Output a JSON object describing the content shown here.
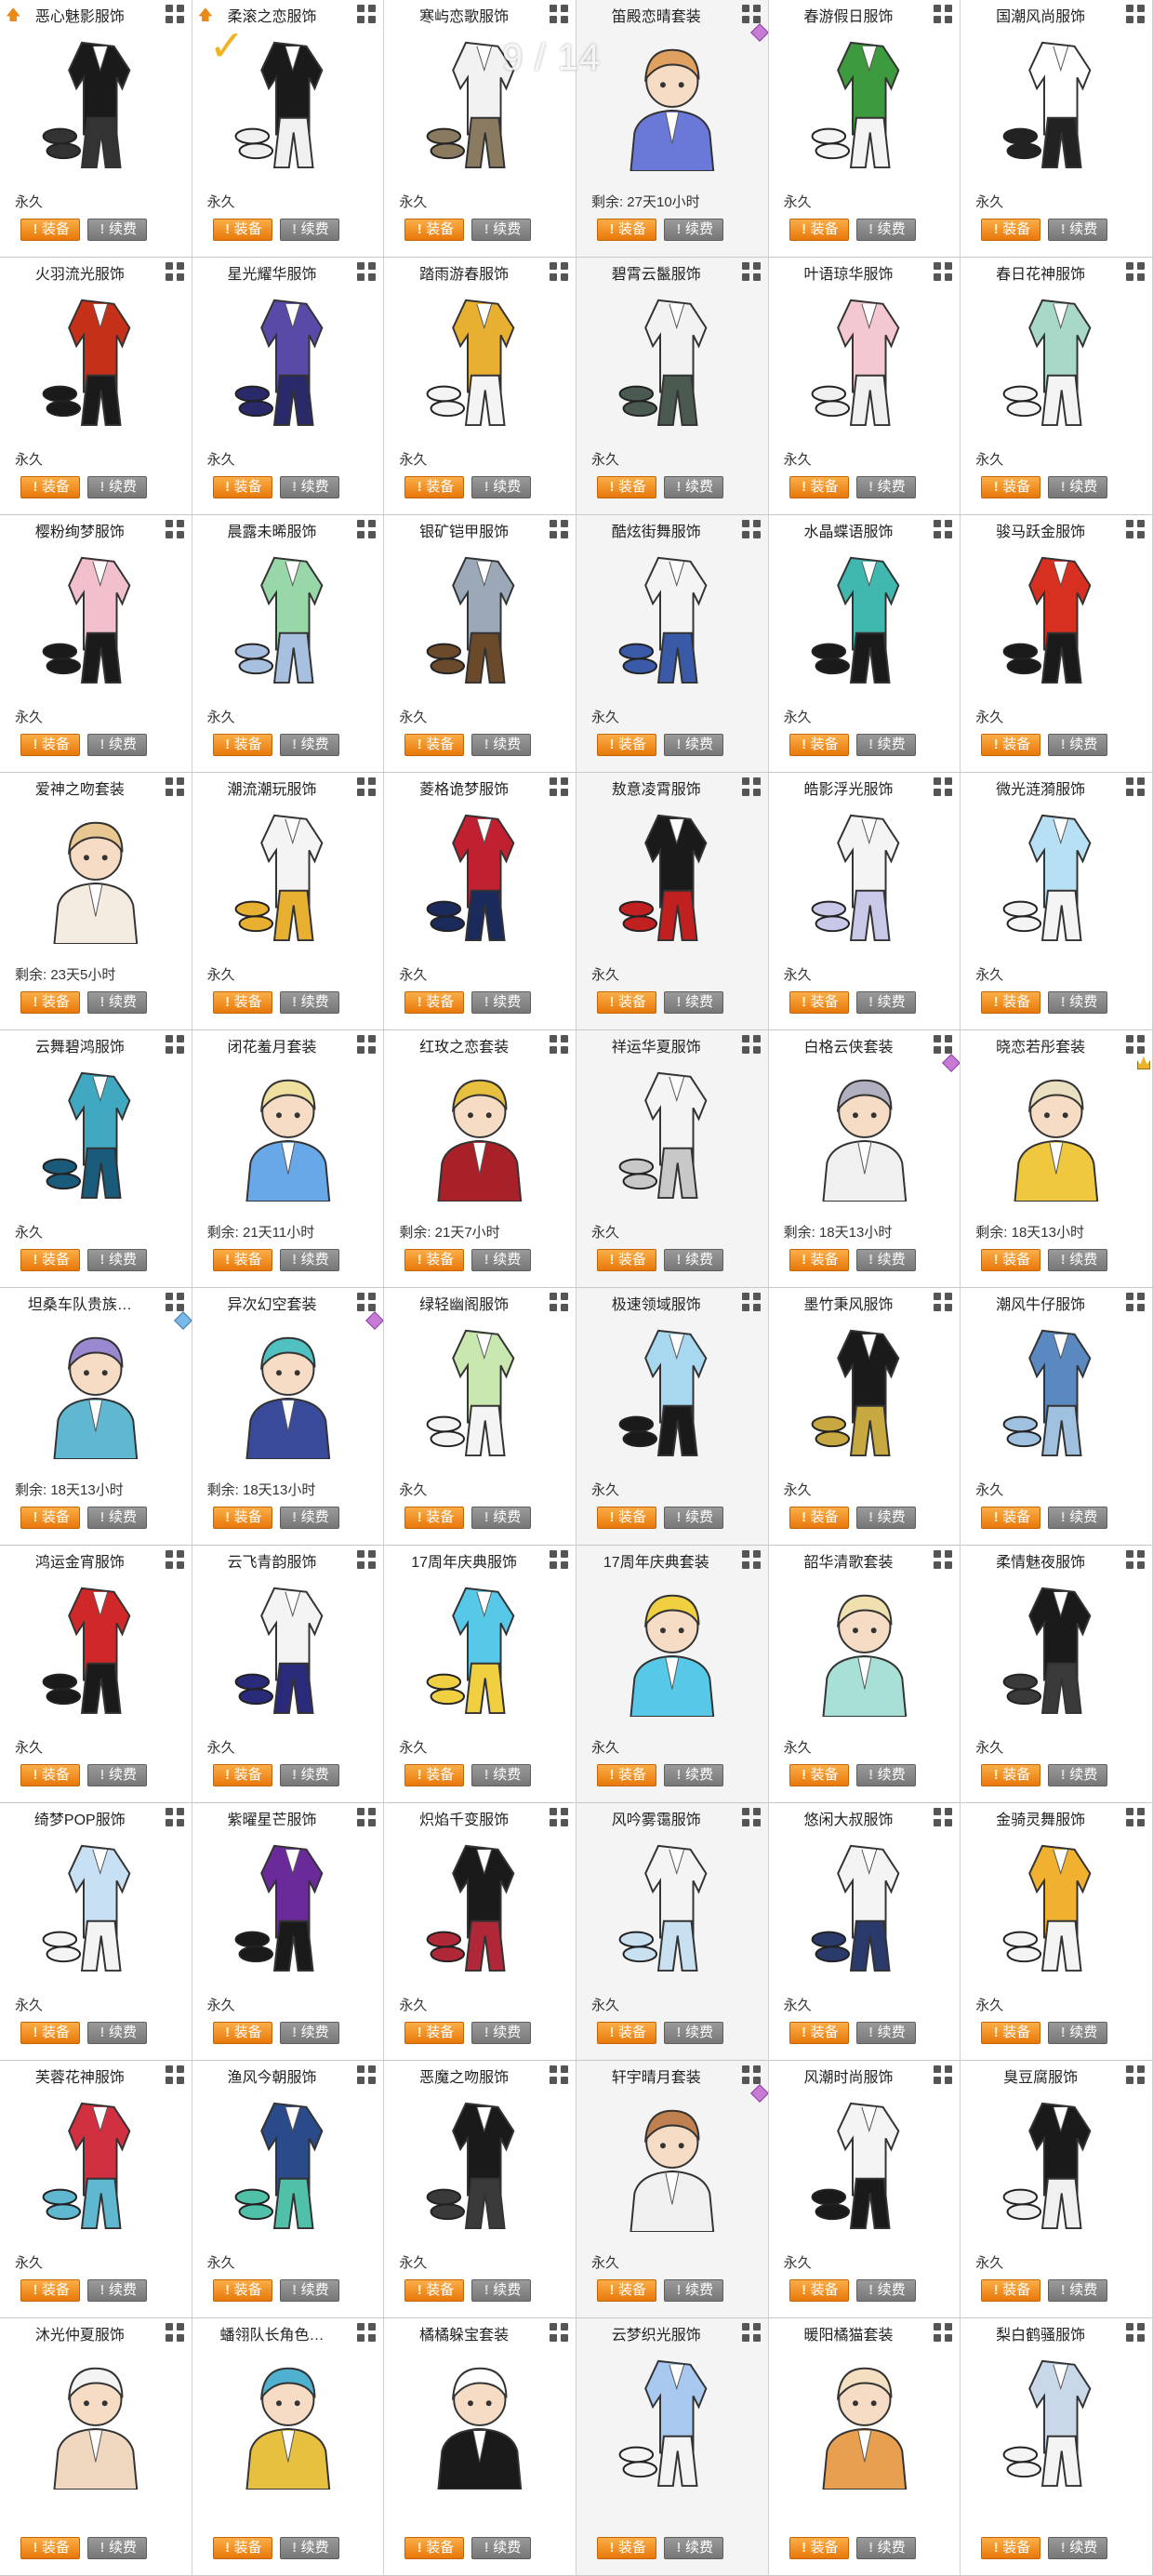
{
  "page_indicator": "9 / 14",
  "labels": {
    "equip": "装备",
    "renew": "续费"
  },
  "items": [
    {
      "name": "恶心魅影服饰",
      "status": "永久",
      "kind": "suit",
      "colors": [
        "#1a1a1a",
        "#333333"
      ],
      "badge": "up"
    },
    {
      "name": "柔滚之恋服饰",
      "status": "永久",
      "kind": "suit",
      "colors": [
        "#1a1a1a",
        "#f0f0f0"
      ],
      "badge": "up",
      "checked": true
    },
    {
      "name": "寒屿恋歌服饰",
      "status": "永久",
      "kind": "suit",
      "colors": [
        "#f2f2f2",
        "#8a7a60"
      ]
    },
    {
      "name": "笛殿恋晴套装",
      "status": "剩余: 27天10小时",
      "kind": "char",
      "colors": [
        "#6a78d8",
        "#e0a060"
      ],
      "gem": "pink"
    },
    {
      "name": "春游假日服饰",
      "status": "永久",
      "kind": "suit",
      "colors": [
        "#3e9a3e",
        "#f4f4f4"
      ]
    },
    {
      "name": "国潮风尚服饰",
      "status": "永久",
      "kind": "suit",
      "colors": [
        "#ffffff",
        "#222222"
      ]
    },
    {
      "name": "火羽流光服饰",
      "status": "永久",
      "kind": "suit",
      "colors": [
        "#c43018",
        "#1a1a1a"
      ]
    },
    {
      "name": "星光耀华服饰",
      "status": "永久",
      "kind": "suit",
      "colors": [
        "#5a4aa8",
        "#2a2a6a"
      ]
    },
    {
      "name": "踏雨游春服饰",
      "status": "永久",
      "kind": "suit",
      "colors": [
        "#e8b030",
        "#f4f4f4"
      ]
    },
    {
      "name": "碧霄云鬣服饰",
      "status": "永久",
      "kind": "suit",
      "colors": [
        "#f2f2f2",
        "#4a5a50"
      ]
    },
    {
      "name": "叶语琼华服饰",
      "status": "永久",
      "kind": "suit",
      "colors": [
        "#f4c8d0",
        "#f0f0f0"
      ]
    },
    {
      "name": "春日花神服饰",
      "status": "永久",
      "kind": "suit",
      "colors": [
        "#a8d8c8",
        "#f4f4f4"
      ]
    },
    {
      "name": "樱粉绚梦服饰",
      "status": "永久",
      "kind": "suit",
      "colors": [
        "#f2c0cc",
        "#1a1a1a"
      ]
    },
    {
      "name": "晨露未晞服饰",
      "status": "永久",
      "kind": "suit",
      "colors": [
        "#98d8a8",
        "#a8c0e0"
      ]
    },
    {
      "name": "银矿铠甲服饰",
      "status": "永久",
      "kind": "suit",
      "colors": [
        "#9aa8b8",
        "#6a4a2a"
      ]
    },
    {
      "name": "酷炫街舞服饰",
      "status": "永久",
      "kind": "suit",
      "colors": [
        "#f4f4f4",
        "#3a5aa8"
      ]
    },
    {
      "name": "水晶蝶语服饰",
      "status": "永久",
      "kind": "suit",
      "colors": [
        "#40b8b0",
        "#1a1a1a"
      ]
    },
    {
      "name": "骏马跃金服饰",
      "status": "永久",
      "kind": "suit",
      "colors": [
        "#d83020",
        "#1a1a1a"
      ]
    },
    {
      "name": "爱神之吻套装",
      "status": "剩余: 23天5小时",
      "kind": "char",
      "colors": [
        "#f4ece0",
        "#e8c890"
      ]
    },
    {
      "name": "潮流潮玩服饰",
      "status": "永久",
      "kind": "suit",
      "colors": [
        "#f4f4f4",
        "#e8b030"
      ]
    },
    {
      "name": "菱格诡梦服饰",
      "status": "永久",
      "kind": "suit",
      "colors": [
        "#c02030",
        "#1a2a5a"
      ]
    },
    {
      "name": "敖意凌霄服饰",
      "status": "永久",
      "kind": "suit",
      "colors": [
        "#1a1a1a",
        "#c02020"
      ]
    },
    {
      "name": "皓影浮光服饰",
      "status": "永久",
      "kind": "suit",
      "colors": [
        "#f4f4f4",
        "#c8c8e8"
      ]
    },
    {
      "name": "微光涟漪服饰",
      "status": "永久",
      "kind": "suit",
      "colors": [
        "#b8e0f4",
        "#f4f4f4"
      ]
    },
    {
      "name": "云舞碧鸿服饰",
      "status": "永久",
      "kind": "suit",
      "colors": [
        "#40a8c0",
        "#1a5a7a"
      ]
    },
    {
      "name": "闭花羞月套装",
      "status": "剩余: 21天11小时",
      "kind": "char",
      "colors": [
        "#68a8e8",
        "#f0e0a0"
      ]
    },
    {
      "name": "红玫之恋套装",
      "status": "剩余: 21天7小时",
      "kind": "char",
      "colors": [
        "#a82028",
        "#e8c040"
      ]
    },
    {
      "name": "祥运华夏服饰",
      "status": "永久",
      "kind": "suit",
      "colors": [
        "#f4f4f4",
        "#c8c8c8"
      ]
    },
    {
      "name": "白格云侠套装",
      "status": "剩余: 18天13小时",
      "kind": "char",
      "colors": [
        "#f0f0f0",
        "#b0b0c0"
      ],
      "gem": "pink"
    },
    {
      "name": "晓恋若彤套装",
      "status": "剩余: 18天13小时",
      "kind": "char",
      "colors": [
        "#f0c840",
        "#e8e0c0"
      ],
      "gem": "crown"
    },
    {
      "name": "坦桑车队贵族…",
      "status": "剩余: 18天13小时",
      "kind": "char",
      "colors": [
        "#60b8d0",
        "#9a88d0"
      ],
      "gem": "blue"
    },
    {
      "name": "异次幻空套装",
      "status": "剩余: 18天13小时",
      "kind": "char",
      "colors": [
        "#3a4a9a",
        "#50c0c0"
      ],
      "gem": "pink"
    },
    {
      "name": "绿轻幽阁服饰",
      "status": "永久",
      "kind": "suit",
      "colors": [
        "#c8e8b0",
        "#f4f4f4"
      ]
    },
    {
      "name": "极速领域服饰",
      "status": "永久",
      "kind": "suit",
      "colors": [
        "#a8d8f0",
        "#1a1a1a"
      ]
    },
    {
      "name": "墨竹秉风服饰",
      "status": "永久",
      "kind": "suit",
      "colors": [
        "#1a1a1a",
        "#c8a840"
      ]
    },
    {
      "name": "潮风牛仔服饰",
      "status": "永久",
      "kind": "suit",
      "colors": [
        "#5a88c0",
        "#a0c0e0"
      ]
    },
    {
      "name": "鸿运金宵服饰",
      "status": "永久",
      "kind": "suit",
      "colors": [
        "#d02828",
        "#1a1a1a"
      ]
    },
    {
      "name": "云飞青韵服饰",
      "status": "永久",
      "kind": "suit",
      "colors": [
        "#f4f4f4",
        "#2a2a7a"
      ]
    },
    {
      "name": "17周年庆典服饰",
      "status": "永久",
      "kind": "suit",
      "colors": [
        "#58c8e8",
        "#f0d040"
      ]
    },
    {
      "name": "17周年庆典套装",
      "status": "永久",
      "kind": "char",
      "colors": [
        "#58c8e8",
        "#f0d040"
      ]
    },
    {
      "name": "韶华清歌套装",
      "status": "永久",
      "kind": "char",
      "colors": [
        "#a8e0d8",
        "#f0e0b0"
      ]
    },
    {
      "name": "柔情魅夜服饰",
      "status": "永久",
      "kind": "suit",
      "colors": [
        "#1a1a1a",
        "#3a3a3a"
      ]
    },
    {
      "name": "绮梦POP服饰",
      "status": "永久",
      "kind": "suit",
      "colors": [
        "#c8e0f4",
        "#f4f4f4"
      ]
    },
    {
      "name": "紫曜星芒服饰",
      "status": "永久",
      "kind": "suit",
      "colors": [
        "#6a2a9a",
        "#1a1a1a"
      ]
    },
    {
      "name": "炽焰千变服饰",
      "status": "永久",
      "kind": "suit",
      "colors": [
        "#1a1a1a",
        "#b02838"
      ]
    },
    {
      "name": "风吟雾霭服饰",
      "status": "永久",
      "kind": "suit",
      "colors": [
        "#f4f4f4",
        "#c8e0f0"
      ]
    },
    {
      "name": "悠闲大叔服饰",
      "status": "永久",
      "kind": "suit",
      "colors": [
        "#f4f4f4",
        "#2a3a6a"
      ]
    },
    {
      "name": "金骑灵舞服饰",
      "status": "永久",
      "kind": "suit",
      "colors": [
        "#f0b030",
        "#f4f4f4"
      ]
    },
    {
      "name": "芙蓉花神服饰",
      "status": "永久",
      "kind": "suit",
      "colors": [
        "#d03040",
        "#60b8d0"
      ]
    },
    {
      "name": "渔风今朝服饰",
      "status": "永久",
      "kind": "suit",
      "colors": [
        "#2a4a8a",
        "#50c0a8"
      ]
    },
    {
      "name": "恶魔之吻服饰",
      "status": "永久",
      "kind": "suit",
      "colors": [
        "#1a1a1a",
        "#3a3a3a"
      ]
    },
    {
      "name": "轩宇晴月套装",
      "status": "永久",
      "kind": "char",
      "colors": [
        "#f0f0f0",
        "#c08050"
      ],
      "gem": "pink"
    },
    {
      "name": "风潮时尚服饰",
      "status": "永久",
      "kind": "suit",
      "colors": [
        "#f4f4f4",
        "#1a1a1a"
      ]
    },
    {
      "name": "臭豆腐服饰",
      "status": "永久",
      "kind": "suit",
      "colors": [
        "#1a1a1a",
        "#f0f0f0"
      ]
    },
    {
      "name": "沐光仲夏服饰",
      "status": "",
      "kind": "char",
      "colors": [
        "#f0d8c0",
        "#f4f4f4"
      ]
    },
    {
      "name": "蟠翎队长角色…",
      "status": "",
      "kind": "char",
      "colors": [
        "#e8c040",
        "#50b0d0"
      ]
    },
    {
      "name": "橘橘躲宝套装",
      "status": "",
      "kind": "char",
      "colors": [
        "#1a1a1a",
        "#ffffff"
      ]
    },
    {
      "name": "云梦织光服饰",
      "status": "",
      "kind": "suit",
      "colors": [
        "#a8c8f0",
        "#f4f4f4"
      ]
    },
    {
      "name": "暖阳橘猫套装",
      "status": "",
      "kind": "char",
      "colors": [
        "#e8a050",
        "#f4e0c0"
      ]
    },
    {
      "name": "梨白鹤骚服饰",
      "status": "",
      "kind": "suit",
      "colors": [
        "#c8d8e8",
        "#f4f4f4"
      ]
    }
  ]
}
